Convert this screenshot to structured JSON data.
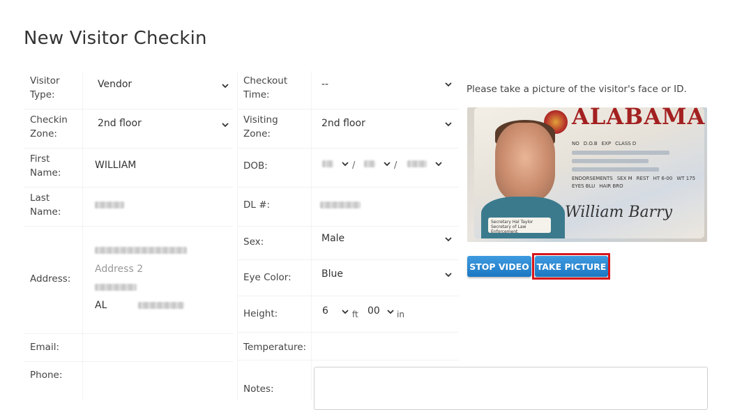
{
  "page": {
    "title": "New Visitor Checkin"
  },
  "left": {
    "visitor_type": {
      "label": "Visitor Type:",
      "value": "Vendor"
    },
    "checkin_zone": {
      "label": "Checkin Zone:",
      "value": "2nd floor"
    },
    "first_name": {
      "label": "First Name:",
      "value": "WILLIAM"
    },
    "last_name": {
      "label": "Last Name:"
    },
    "address": {
      "label": "Address:",
      "line2_placeholder": "Address 2",
      "state": "AL"
    },
    "email": {
      "label": "Email:"
    },
    "phone": {
      "label": "Phone:"
    }
  },
  "middle": {
    "checkout_time": {
      "label": "Checkout Time:",
      "value": "--"
    },
    "visiting_zone": {
      "label": "Visiting Zone:",
      "value": "2nd floor"
    },
    "dob": {
      "label": "DOB:",
      "separator": "/"
    },
    "dl": {
      "label": "DL #:"
    },
    "sex": {
      "label": "Sex:",
      "value": "Male"
    },
    "eye_color": {
      "label": "Eye Color:",
      "value": "Blue"
    },
    "height": {
      "label": "Height:",
      "feet": "6",
      "feet_unit": "ft",
      "inches": "00",
      "inches_unit": "in"
    },
    "temperature": {
      "label": "Temperature:"
    },
    "notes": {
      "label": "Notes:"
    }
  },
  "right": {
    "hint": "Please take a picture of the visitor's face or ID.",
    "id_card": {
      "state": "ALABAMA",
      "class": "CLASS D",
      "signature": "William Barry",
      "footer": "Secretary Hal Taylor Secretary of Law Enforcement",
      "fields": [
        "NO",
        "D.O.B",
        "EXP",
        "HT 6-00",
        "WT 175",
        "EYES BLU",
        "HAIR BRO",
        "SEX M",
        "REST",
        "ENDORSEMENTS"
      ]
    },
    "buttons": {
      "stop_video": "STOP VIDEO",
      "take_picture": "TAKE PICTURE"
    }
  },
  "colors": {
    "button": "#1c77c3",
    "highlight": "#d7151a",
    "title": "#333333"
  },
  "icons": {
    "dropdown": "chevron-down-icon"
  }
}
